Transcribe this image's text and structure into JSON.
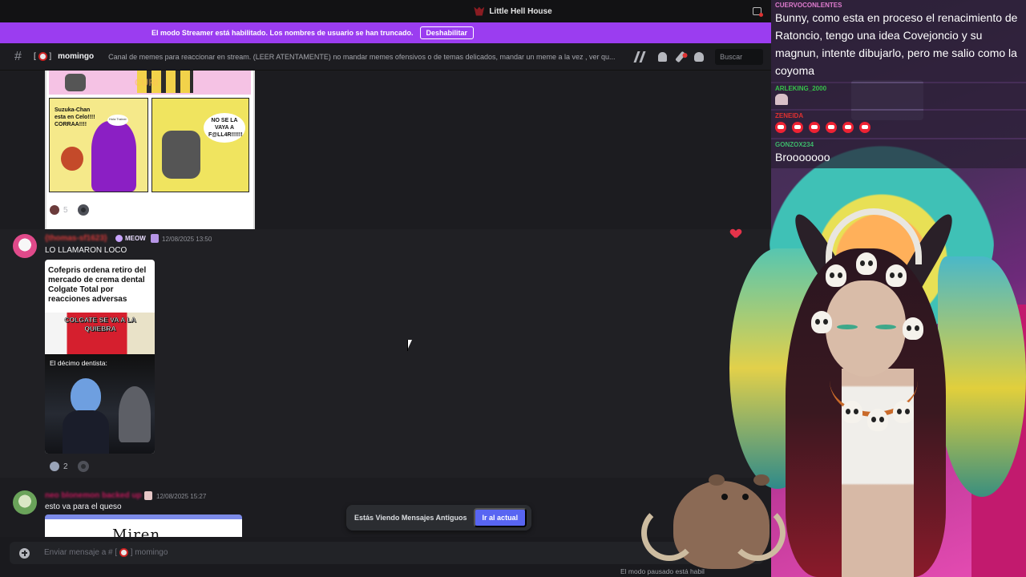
{
  "window": {
    "title": "Little Hell House"
  },
  "banner": {
    "text": "El modo Streamer está habilitado. Los nombres de usuario se han truncado.",
    "button": "Deshabilitar"
  },
  "channel": {
    "name": "momingo",
    "topic": "Canal de memes para reaccionar en stream. (LEER ATENTAMENTE) no mandar memes ofensivos o de temas delicados, mandar un meme a la vez , ver qu...",
    "search_placeholder": "Buscar"
  },
  "comic": {
    "bubble_left": "Suzuka-Chan esta en Celo!!!! CORRAA!!!!",
    "bubble_right": "NO SE LA VAYA A F@LL4R!!!!!!",
    "bubble_mini": "Hola Trainer",
    "watermark": "CURI"
  },
  "messages": [
    {
      "reaction_count": "5"
    },
    {
      "username": "{thomas-sf1623}",
      "badge": "MEOW",
      "timestamp": "12/08/2025 13:50",
      "text": "LO LLAMARON LOCO",
      "embed": {
        "headline": "Cofepris ordena retiro del mercado de crema dental Colgate Total por reacciones adversas",
        "caption": "COLGATE SE VA A LA QUIEBRA",
        "meme_caption": "El décimo dentista:"
      },
      "reaction_count": "2"
    },
    {
      "username": "neo blonemon backed up",
      "timestamp": "12/08/2025 15:27",
      "text": "esto va para el queso",
      "drawing_text": "Miren"
    }
  ],
  "old_messages": {
    "text": "Estás Viendo Mensajes Antiguos",
    "button": "Ir al actual"
  },
  "composer": {
    "placeholder": "Enviar mensaje a #",
    "channel": "momingo"
  },
  "paused_text": "El modo pausado está habil",
  "stream_chat": [
    {
      "user": "CUERVOCONLENTES",
      "color": "#e07cd0",
      "text": "Bunny, como esta en proceso el renacimiento de Ratoncio, tengo una idea Covejoncio y su magnun, intente dibujarlo, pero me salio como la coyoma"
    },
    {
      "user": "ARLEKING_2000",
      "color": "#36c24a",
      "text": ""
    },
    {
      "user": "ZENEIDA",
      "color": "#e03030",
      "text": ""
    },
    {
      "user": "GONZOX234",
      "color": "#3db86a",
      "text": "Brooooooo"
    }
  ],
  "colors": {
    "accent": "#9b3df0",
    "jump": "#5865f2",
    "username_red": "#d83a3a"
  }
}
